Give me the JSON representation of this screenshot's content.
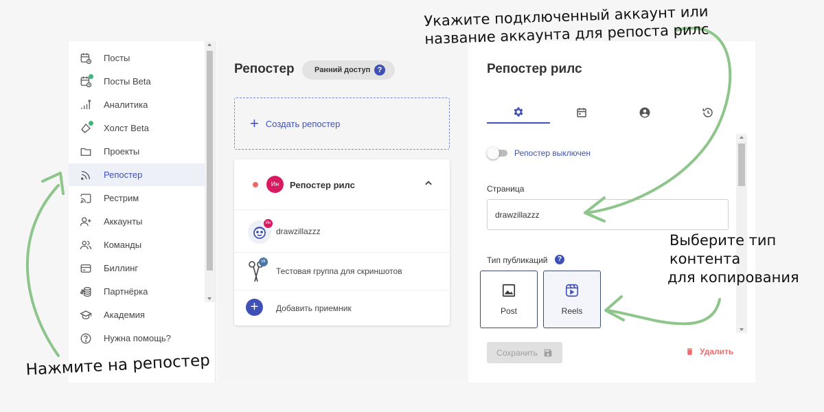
{
  "colors": {
    "accent": "#3f51b5",
    "active_bg": "#eef0f7",
    "annotation_arrow": "#8dc58b",
    "danger": "#ef6b6b",
    "beta_dot": "#3cb878"
  },
  "sidebar": {
    "items": [
      {
        "label": "Посты",
        "icon": "calendar-clock-icon",
        "active": false,
        "beta_dot": false
      },
      {
        "label": "Посты Beta",
        "icon": "calendar-clock-icon",
        "active": false,
        "beta_dot": true
      },
      {
        "label": "Аналитика",
        "icon": "bar-chart-icon",
        "active": false,
        "beta_dot": false
      },
      {
        "label": "Холст Beta",
        "icon": "canvas-icon",
        "active": false,
        "beta_dot": true
      },
      {
        "label": "Проекты",
        "icon": "folder-icon",
        "active": false,
        "beta_dot": false
      },
      {
        "label": "Репостер",
        "icon": "rss-icon",
        "active": true,
        "beta_dot": false
      },
      {
        "label": "Рестрим",
        "icon": "cast-icon",
        "active": false,
        "beta_dot": false
      },
      {
        "label": "Аккаунты",
        "icon": "add-user-icon",
        "active": false,
        "beta_dot": false
      },
      {
        "label": "Команды",
        "icon": "team-icon",
        "active": false,
        "beta_dot": false
      },
      {
        "label": "Биллинг",
        "icon": "credit-card-icon",
        "active": false,
        "beta_dot": false
      },
      {
        "label": "Партнёрка",
        "icon": "coins-icon",
        "active": false,
        "beta_dot": false
      },
      {
        "label": "Академия",
        "icon": "graduation-cap-icon",
        "active": false,
        "beta_dot": false
      },
      {
        "label": "Нужна помощь?",
        "icon": "help-icon",
        "active": false,
        "beta_dot": false
      }
    ]
  },
  "middle": {
    "title": "Репостер",
    "badge": "Ранний доступ",
    "badge_help": "?",
    "create_label": "Создать репостер",
    "create_plus": "+",
    "card": {
      "title": "Репостер рилс",
      "avatar_text": "Ин",
      "rows": [
        {
          "text": "drawzillazzz",
          "badge": "Ин"
        },
        {
          "text": "Тестовая группа для скриншотов",
          "badge": "vk"
        },
        {
          "text": "Добавить приемник",
          "plus": "+"
        }
      ]
    }
  },
  "right": {
    "title": "Репостер рилс",
    "tabs": [
      "gear-icon",
      "calendar-icon",
      "account-icon",
      "history-icon"
    ],
    "toggle_label": "Репостер выключен",
    "toggle_on": false,
    "page_label": "Страница",
    "page_value": "drawzillazzz",
    "type_label": "Тип публикаций",
    "type_help": "?",
    "types": [
      {
        "label": "Post",
        "selected": false
      },
      {
        "label": "Reels",
        "selected": true
      }
    ],
    "save_label": "Сохранить",
    "delete_label": "Удалить"
  },
  "annotations": {
    "top_line1": "Укажите подключенный аккаунт или",
    "top_line2": "название аккаунта для репоста рилс",
    "right_line1": "Выберите тип",
    "right_line2": "контента",
    "right_line3": "для копирования",
    "bottom": "Нажмите на репостер"
  }
}
